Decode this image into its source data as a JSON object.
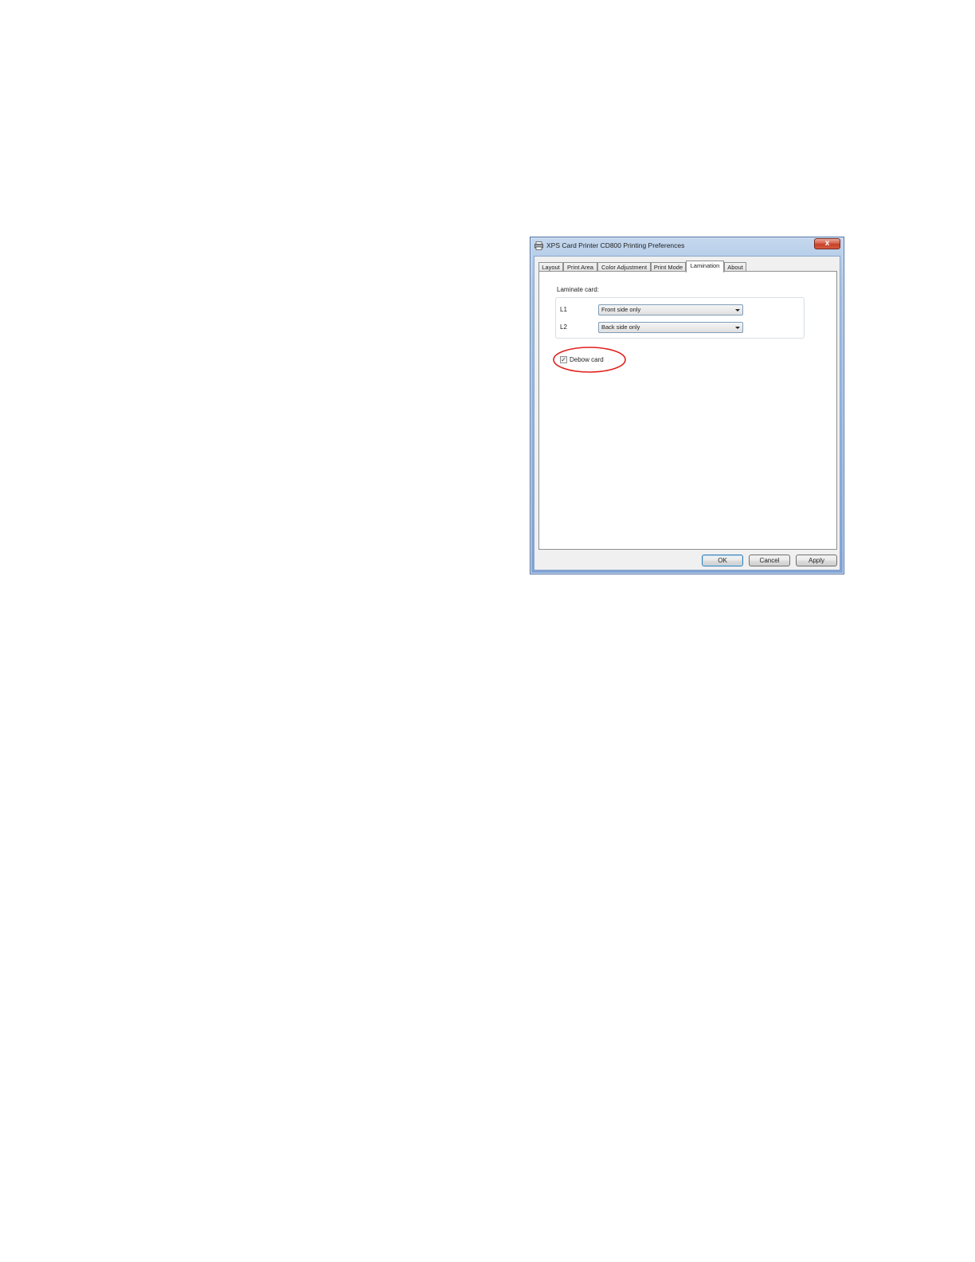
{
  "window": {
    "title": "XPS Card Printer CD800 Printing Preferences",
    "close_label": "x"
  },
  "tabs": [
    {
      "label": "Layout"
    },
    {
      "label": "Print Area"
    },
    {
      "label": "Color Adjustment"
    },
    {
      "label": "Print Mode"
    },
    {
      "label": "Lamination",
      "active": true
    },
    {
      "label": "About"
    }
  ],
  "lamination": {
    "group_label": "Laminate card:",
    "l1": {
      "label": "L1",
      "value": "Front side only"
    },
    "l2": {
      "label": "L2",
      "value": "Back side only"
    },
    "debow": {
      "label": "Debow card",
      "checked": true
    }
  },
  "buttons": {
    "ok": "OK",
    "cancel": "Cancel",
    "apply": "Apply"
  },
  "colors": {
    "highlight_oval": "#e0201b",
    "window_frame": "#4a6fa3"
  }
}
